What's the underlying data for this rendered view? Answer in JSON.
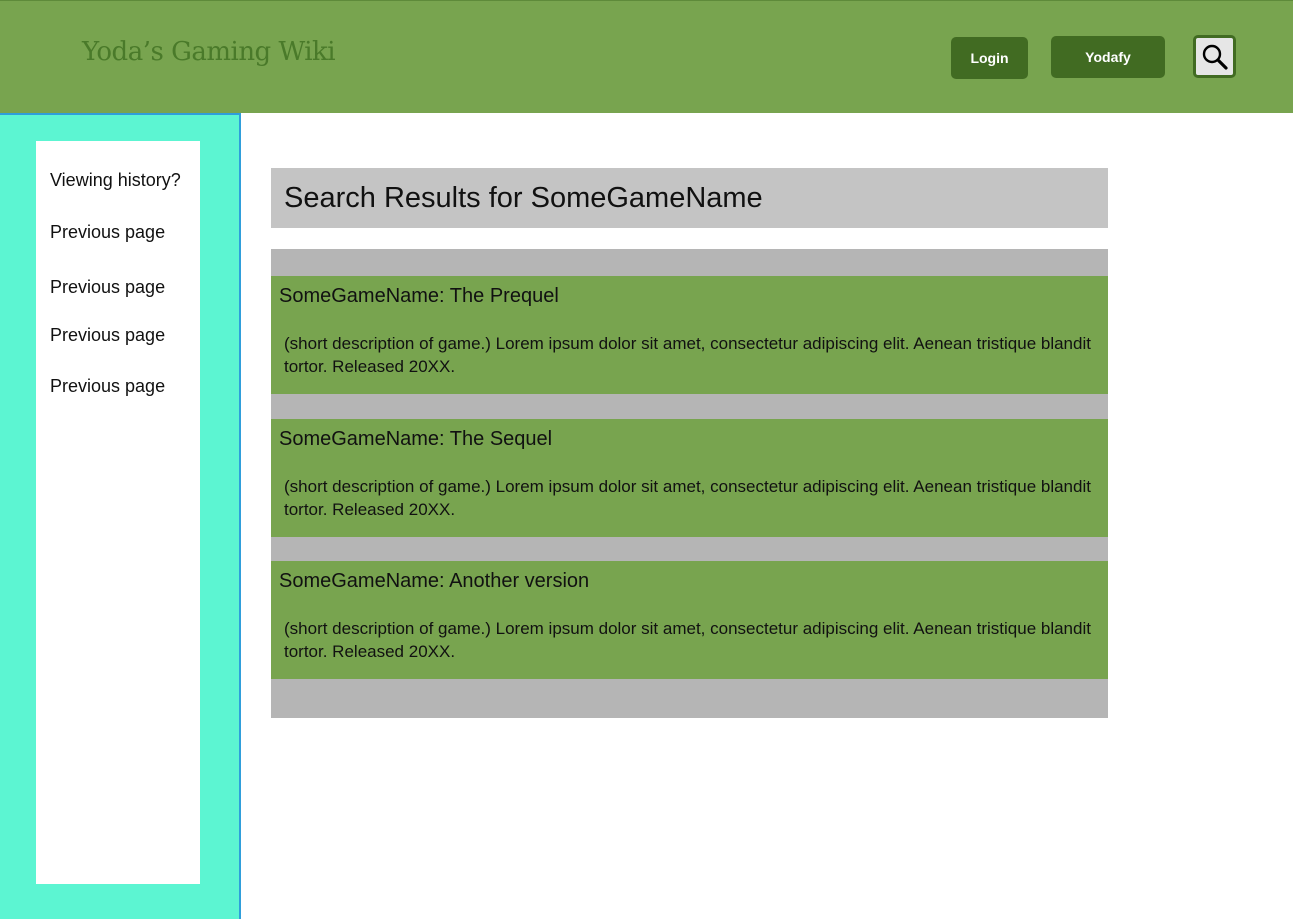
{
  "header": {
    "site_title": "Yoda’s Gaming Wiki",
    "login_label": "Login",
    "yodafy_label": "Yodafy",
    "search_icon": "magnifying-glass-icon"
  },
  "sidebar": {
    "items": [
      {
        "label": "Viewing history?"
      },
      {
        "label": "Previous page"
      },
      {
        "label": "Previous page"
      },
      {
        "label": "Previous page"
      },
      {
        "label": "Previous page"
      }
    ]
  },
  "main": {
    "results_title": "Search Results for SomeGameName",
    "results": [
      {
        "title": "SomeGameName: The Prequel",
        "description": "(short description of game.) Lorem ipsum dolor sit amet, consectetur adipiscing elit. Aenean tristique blandit tortor. Released 20XX."
      },
      {
        "title": "SomeGameName: The Sequel",
        "description": "(short description of game.) Lorem ipsum dolor sit amet, consectetur adipiscing elit. Aenean tristique blandit tortor. Released 20XX."
      },
      {
        "title": "SomeGameName: Another version",
        "description": "(short description of game.) Lorem ipsum dolor sit amet, consectetur adipiscing elit. Aenean tristique blandit tortor. Released 20XX."
      }
    ]
  },
  "colors": {
    "header_bg": "#78a44f",
    "button_bg": "#416b22",
    "sidebar_bg": "#5cf5d2",
    "sidebar_border": "#2f9edb",
    "results_header_bg": "#c4c4c4",
    "results_list_bg": "#b5b5b5",
    "result_card_bg": "#78a44f"
  }
}
